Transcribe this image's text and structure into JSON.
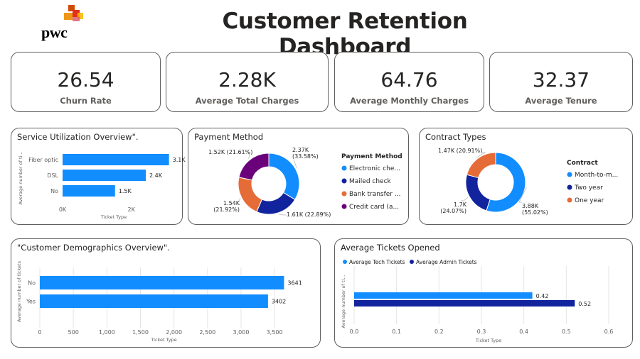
{
  "header": {
    "logo_text": "pwc",
    "title": "Customer Retention Dashboard"
  },
  "kpis": [
    {
      "value": "26.54",
      "label": "Churn Rate"
    },
    {
      "value": "2.28K",
      "label": "Average Total Charges"
    },
    {
      "value": "64.76",
      "label": "Average Monthly Charges"
    },
    {
      "value": "32.37",
      "label": "Average Tenure"
    }
  ],
  "colors": {
    "blue": "#118DFF",
    "navy": "#12239E",
    "orange": "#E66C37",
    "purple": "#6B007B",
    "logo_orange": "#E0301E",
    "logo_amber": "#FFB600",
    "logo_red": "#D04A02"
  },
  "service_panel": {
    "title": "Service Utilization Overview\"."
  },
  "payment_panel": {
    "title": "Payment Method"
  },
  "contract_panel": {
    "title": "Contract Types"
  },
  "demographics_panel": {
    "title": "\"Customer Demographics Overview\"."
  },
  "tickets_panel": {
    "title": "Average Tickets Opened"
  },
  "chart_data": [
    {
      "type": "bar",
      "orientation": "horizontal",
      "categories": [
        "Fiber optic",
        "DSL",
        "No"
      ],
      "values": [
        3096,
        2421,
        1526
      ],
      "data_labels": [
        "3.1K",
        "2.4K",
        "1.5K"
      ],
      "xlabel": "Ticket Type",
      "ylabel": "Average number of ti...",
      "xticks": [
        "0K",
        "2K"
      ],
      "xlim": [
        0,
        3600
      ],
      "color": "#118DFF"
    },
    {
      "type": "pie",
      "donut": true,
      "legend_title": "Payment Method",
      "legend": [
        "Electronic che...",
        "Mailed check",
        "Bank transfer ...",
        "Credit card (a..."
      ],
      "values": [
        2370,
        1610,
        1540,
        1520
      ],
      "labels": [
        "2.37K\n(33.58%)",
        "1.61K (22.89%)",
        "1.54K\n(21.92%)",
        "1.52K (21.61%)"
      ],
      "colors": [
        "#118DFF",
        "#12239E",
        "#E66C37",
        "#6B007B"
      ]
    },
    {
      "type": "pie",
      "donut": true,
      "legend_title": "Contract",
      "legend": [
        "Month-to-m...",
        "Two year",
        "One year"
      ],
      "values": [
        3880,
        1700,
        1470
      ],
      "labels": [
        "3.88K\n(55.02%)",
        "1.7K\n(24.07%)",
        "1.47K (20.91%)"
      ],
      "colors": [
        "#118DFF",
        "#12239E",
        "#E66C37"
      ]
    },
    {
      "type": "bar",
      "orientation": "horizontal",
      "categories": [
        "No",
        "Yes"
      ],
      "values": [
        3641,
        3402
      ],
      "data_labels": [
        "3641",
        "3402"
      ],
      "xlabel": "Ticket Type",
      "ylabel": "Average number of tickets",
      "xticks": [
        "0",
        "500",
        "1,000",
        "1,500",
        "2,000",
        "2,500",
        "3,000",
        "3,500"
      ],
      "xlim": [
        0,
        3700
      ],
      "color": "#118DFF"
    },
    {
      "type": "bar",
      "orientation": "horizontal",
      "series": [
        {
          "name": "Average Tech Tickets",
          "values": [
            0.42
          ],
          "color": "#118DFF"
        },
        {
          "name": "Average Admin Tickets",
          "values": [
            0.52
          ],
          "color": "#12239E"
        }
      ],
      "data_labels": [
        "0.42",
        "0.52"
      ],
      "xlabel": "Ticket Type",
      "ylabel": "Average number of ti...",
      "xticks": [
        "0.0",
        "0.1",
        "0.2",
        "0.3",
        "0.4",
        "0.5",
        "0.6"
      ],
      "xlim": [
        0,
        0.6
      ]
    }
  ]
}
